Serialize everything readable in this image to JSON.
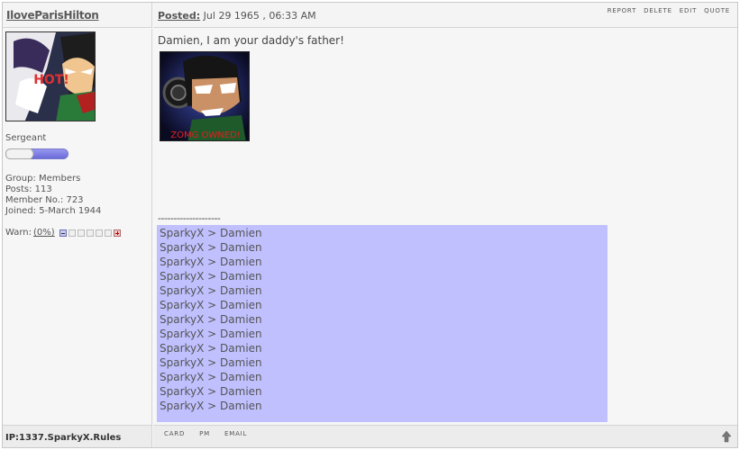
{
  "author": {
    "username": "IloveParisHilton",
    "rank": "Sergeant",
    "info": {
      "group": "Group: Members",
      "posts": "Posts: 113",
      "member_no": "Member No.: 723",
      "joined": "Joined: 5-March 1944"
    },
    "warn_label": "Warn:",
    "warn_pct": "(0%)",
    "ip": "IP:1337.SparkyX.Rules",
    "avatar_text": "HOT!"
  },
  "post_header": {
    "posted_label": "Posted:",
    "posted_date": "Jul 29 1965 , 06:33 AM",
    "actions": [
      "REPORT",
      "DELETE",
      "EDIT",
      "QUOTE"
    ]
  },
  "post": {
    "text": "Damien, I am your daddy's father!",
    "image_caption": "ZOMG OWNED!",
    "separator": "--------------------"
  },
  "signature": {
    "lines": [
      "SparkyX > Damien",
      "SparkyX > Damien",
      "SparkyX > Damien",
      "SparkyX > Damien",
      "SparkyX > Damien",
      "SparkyX > Damien",
      "SparkyX > Damien",
      "SparkyX > Damien",
      "SparkyX > Damien",
      "SparkyX > Damien",
      "SparkyX > Damien",
      "SparkyX > Damien",
      "SparkyX > Damien"
    ],
    "background": "#c0c0ff"
  },
  "footer": {
    "actions": [
      "CARD",
      "PM",
      "EMAIL"
    ]
  },
  "icons": {
    "to_top": "arrow-up-icon"
  }
}
